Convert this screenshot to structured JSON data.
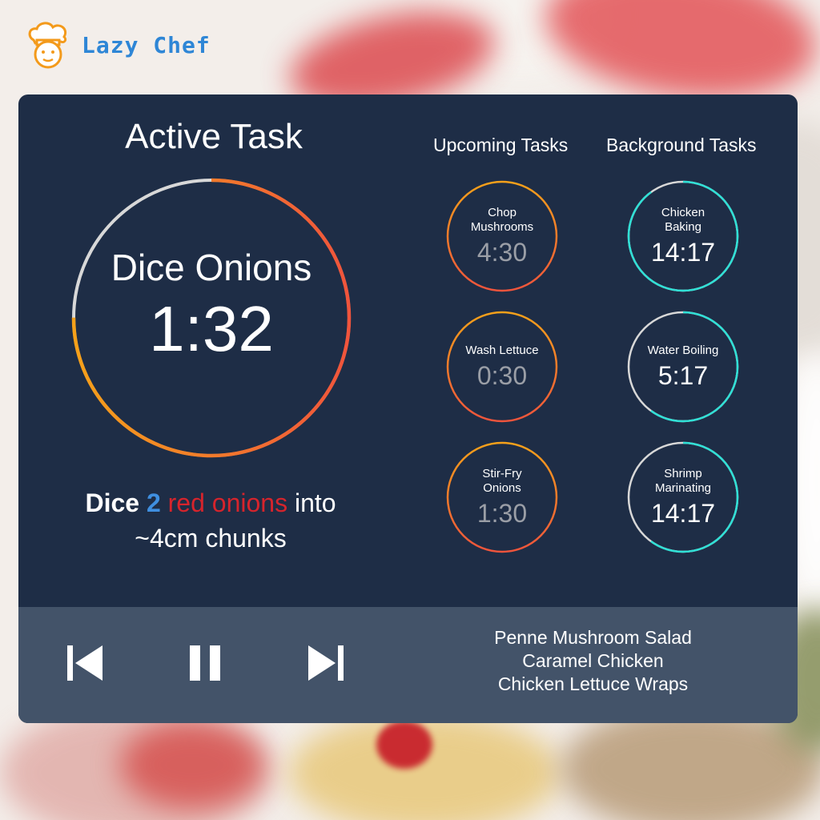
{
  "app": {
    "name": "Lazy Chef"
  },
  "active": {
    "header": "Active Task",
    "name": "Dice Onions",
    "time": "1:32",
    "progress": 0.75,
    "instruction": {
      "verb": "Dice",
      "quantity": "2",
      "ingredient": "red onions",
      "rest": "into",
      "line2": "~4cm chunks"
    }
  },
  "upcoming": {
    "header": "Upcoming Tasks",
    "tasks": [
      {
        "name": "Chop Mushrooms",
        "time": "4:30"
      },
      {
        "name": "Wash Lettuce",
        "time": "0:30"
      },
      {
        "name": "Stir-Fry Onions",
        "time": "1:30"
      }
    ]
  },
  "background": {
    "header": "Background Tasks",
    "tasks": [
      {
        "name": "Chicken Baking",
        "time": "14:17",
        "progress": 0.9
      },
      {
        "name": "Water Boiling",
        "time": "5:17",
        "progress": 0.6
      },
      {
        "name": "Shrimp Marinating",
        "time": "14:17",
        "progress": 0.6
      }
    ]
  },
  "controls": {
    "previous": "previous-icon",
    "pause": "pause-icon",
    "next": "next-icon"
  },
  "recipes": [
    "Penne Mushroom Salad",
    "Caramel Chicken",
    "Chicken Lettuce Wraps"
  ],
  "colors": {
    "panel": "#1e2d46",
    "controls_bar": "#435369",
    "orange": "#f5a11a",
    "red_orange": "#f0543c",
    "teal": "#2fe0d6",
    "track": "#d8d8d8"
  }
}
